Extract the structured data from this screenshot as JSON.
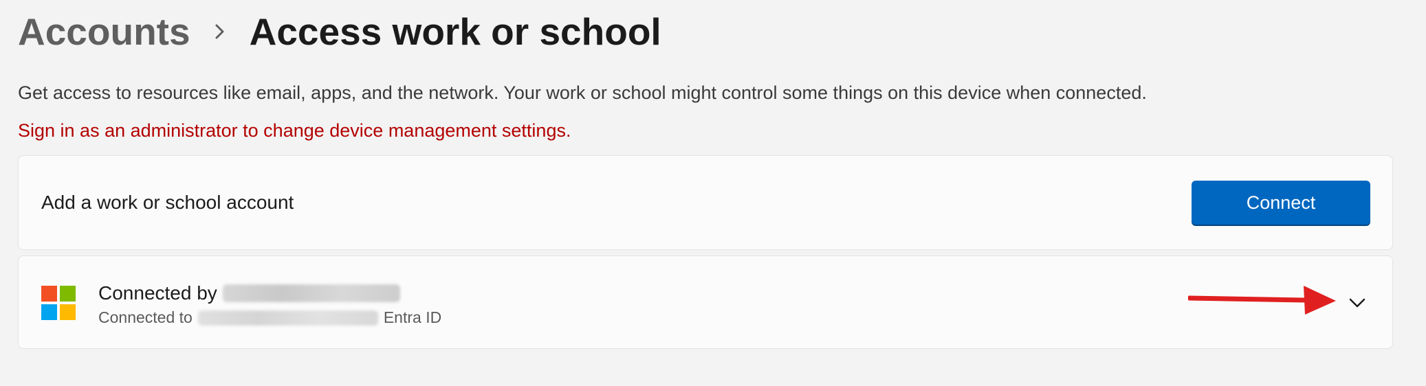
{
  "breadcrumb": {
    "parent": "Accounts",
    "current": "Access work or school"
  },
  "description": "Get access to resources like email, apps, and the network. Your work or school might control some things on this device when connected.",
  "admin_warning": "Sign in as an administrator to change device management settings.",
  "add_account": {
    "label": "Add a work or school account",
    "button_label": "Connect"
  },
  "connected_account": {
    "title_prefix": "Connected by",
    "subtitle_prefix": "Connected to",
    "subtitle_suffix": "Entra ID",
    "logo_colors": [
      "#f25022",
      "#7fba00",
      "#00a4ef",
      "#ffb900"
    ]
  },
  "colors": {
    "accent": "#0067c0",
    "warning": "#b40000",
    "annotation_arrow": "#e02020"
  },
  "icons": {
    "breadcrumb_separator": "chevron-right-icon",
    "expand": "chevron-down-icon",
    "logo": "microsoft-logo-icon"
  }
}
